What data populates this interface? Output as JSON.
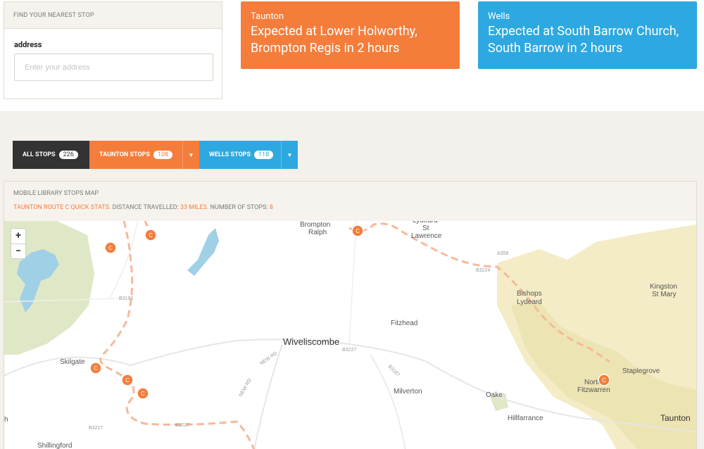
{
  "finder": {
    "title": "Find your nearest stop",
    "field_label": "address",
    "placeholder": "Enter your address"
  },
  "cards": [
    {
      "route": "Taunton",
      "message": "Expected at Lower Holworthy, Brompton Regis in 2 hours",
      "color": "#f47d3b"
    },
    {
      "route": "Wells",
      "message": "Expected at South Barrow Church, South Barrow in 2 hours",
      "color": "#2ea8e0"
    }
  ],
  "tabs": [
    {
      "label": "All stops",
      "count": "226"
    },
    {
      "label": "Taunton stops",
      "count": "108"
    },
    {
      "label": "Wells stops",
      "count": "118"
    }
  ],
  "map": {
    "title": "Mobile library stops map",
    "stats_prefix": "Taunton route C quick stats.",
    "distance_label": "Distance travelled:",
    "distance_value": "33 miles.",
    "stops_label": "Number of stops:",
    "stops_value": "8",
    "zoom_in": "+",
    "zoom_out": "−",
    "marker_letter": "C",
    "places": [
      "Brompton Ralph",
      "Lydeard St Lawrence",
      "Bishops Lydeard",
      "Kingston St Mary",
      "Fitzhead",
      "Wiveliscombe",
      "Skilgate",
      "Staplegrove",
      "Norton Fitzwarren",
      "Milverton",
      "Oake",
      "Hillfarrance",
      "Taunton",
      "Shillingford"
    ],
    "roads": [
      "B3190",
      "B3227",
      "B3224",
      "A358",
      "B3187",
      "NEW RD"
    ]
  }
}
